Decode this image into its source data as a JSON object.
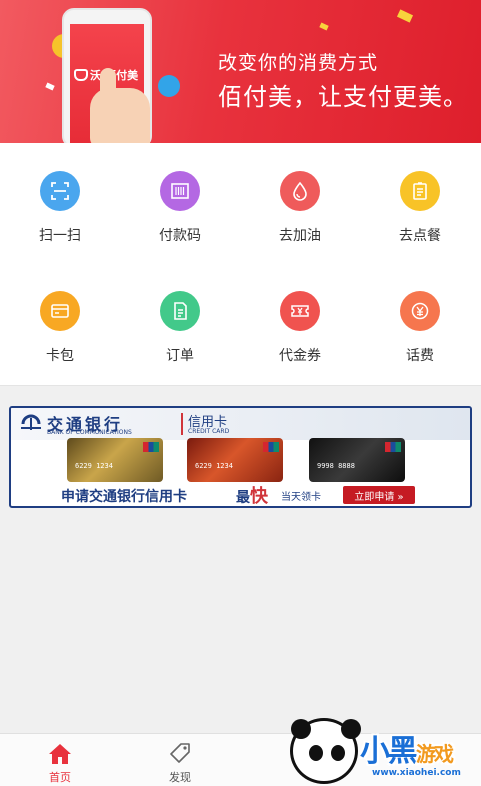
{
  "banner": {
    "line1": "改变你的消费方式",
    "line2": "佰付美，让支付更美。",
    "phone_logo": "沃·佰付美"
  },
  "grid": {
    "items": [
      {
        "label": "扫一扫",
        "icon": "scan-icon",
        "color": "#4aa6ee"
      },
      {
        "label": "付款码",
        "icon": "barcode-icon",
        "color": "#b468e3"
      },
      {
        "label": "去加油",
        "icon": "drop-icon",
        "color": "#ef5b5b"
      },
      {
        "label": "去点餐",
        "icon": "menu-icon",
        "color": "#f8c327"
      },
      {
        "label": "卡包",
        "icon": "card-icon",
        "color": "#f8a823"
      },
      {
        "label": "订单",
        "icon": "order-icon",
        "color": "#42c98a"
      },
      {
        "label": "代金券",
        "icon": "voucher-icon",
        "color": "#f0534f"
      },
      {
        "label": "话费",
        "icon": "yen-icon",
        "color": "#f6764e"
      }
    ]
  },
  "ad": {
    "bank_name": "交通银行",
    "bank_en": "BANK OF COMMUNICATIONS",
    "credit_cn": "信用卡",
    "credit_en": "CREDIT CARD",
    "card_nums": [
      "6229 1234",
      "6229 1234",
      "9998 8888"
    ],
    "slogan": "申请交通银行信用卡",
    "fast_prefix": "最",
    "fast_word": "快",
    "same_day": "当天领卡",
    "cta": "立即申请 »"
  },
  "tabbar": {
    "tabs": [
      {
        "label": "首页",
        "active": true
      },
      {
        "label": "发现",
        "active": false
      }
    ]
  },
  "watermark": {
    "text_a": "小黑",
    "text_b": "游戏",
    "url": "www.xiaohei.com"
  },
  "colors": {
    "accent": "#e8323d",
    "bank_blue": "#1f3e82"
  }
}
